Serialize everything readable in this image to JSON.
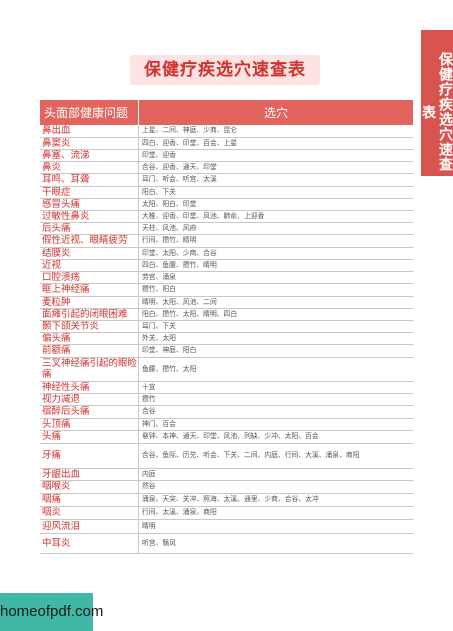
{
  "side_tab": "保健疗疾选穴速查表",
  "title": "保健疗疾选穴速查表",
  "table": {
    "headers": [
      "头面部健康问题",
      "选穴"
    ],
    "rows": [
      {
        "name": "鼻出血",
        "points": "上星、二间、神庭、少商、昆仑"
      },
      {
        "name": "鼻窦炎",
        "points": "四白、迎香、印堂、百会、上星"
      },
      {
        "name": "鼻塞、流涕",
        "points": "印堂、迎香"
      },
      {
        "name": "鼻炎",
        "points": "合谷、迎香、通天、印堂"
      },
      {
        "name": "耳鸣、耳聋",
        "points": "耳门、听会、听宫、太溪"
      },
      {
        "name": "干眼症",
        "points": "阳白、下关"
      },
      {
        "name": "感冒头痛",
        "points": "太阳、阳白、印堂"
      },
      {
        "name": "过敏性鼻炎",
        "points": "大椎、迎香、印堂、风池、肺俞、上迎香"
      },
      {
        "name": "后头痛",
        "points": "天柱、风池、风府"
      },
      {
        "name": "假性近视、眼睛疲劳",
        "points": "行间、攒竹、睛明"
      },
      {
        "name": "结膜炎",
        "points": "印堂、太阳、少商、合谷"
      },
      {
        "name": "近视",
        "points": "四白、鱼腰、攒竹、睛明"
      },
      {
        "name": "口腔溃疡",
        "points": "劳宫、涌泉"
      },
      {
        "name": "眶上神经痛",
        "points": "攒竹、阳白"
      },
      {
        "name": "麦粒肿",
        "points": "睛明、太阳、风池、二间"
      },
      {
        "name": "面瘫引起的闭眼困难",
        "points": "阳白、攒竹、太阳、睛明、四白"
      },
      {
        "name": "颞下颌关节炎",
        "points": "耳门、下关"
      },
      {
        "name": "偏头痛",
        "points": "外关、太阳"
      },
      {
        "name": "前额痛",
        "points": "印堂、神庭、阳白"
      },
      {
        "name": "三叉神经痛引起的眼睑痛",
        "points": "鱼腰、攒竹、太阳"
      },
      {
        "name": "神经性头痛",
        "points": "十宣"
      },
      {
        "name": "视力减退",
        "points": "攒竹"
      },
      {
        "name": "宿醉后头痛",
        "points": "合谷"
      },
      {
        "name": "头顶痛",
        "points": "神门、百会"
      },
      {
        "name": "头痛",
        "points": "悬钟、本神、通天、印堂、风池、列缺、少冲、太阳、百会"
      },
      {
        "name": "牙痛",
        "points": "合谷、鱼际、历兑、听会、下关、二间、内庭、行间、大溪、涌泉、商阳"
      },
      {
        "name": "牙龈出血",
        "points": "内庭"
      },
      {
        "name": "咽喉炎",
        "points": "然谷"
      },
      {
        "name": "咽痛",
        "points": "涌泉、天突、关冲、照海、太溪、通里、少商、合谷、太冲"
      },
      {
        "name": "咽炎",
        "points": "行间、太溪、涌泉、商阳"
      },
      {
        "name": "迎风流泪",
        "points": "睛明"
      },
      {
        "name": "中耳炎",
        "points": "听宫、翳风"
      }
    ]
  },
  "footer": {
    "watermark": "homeofpdf.com"
  }
}
